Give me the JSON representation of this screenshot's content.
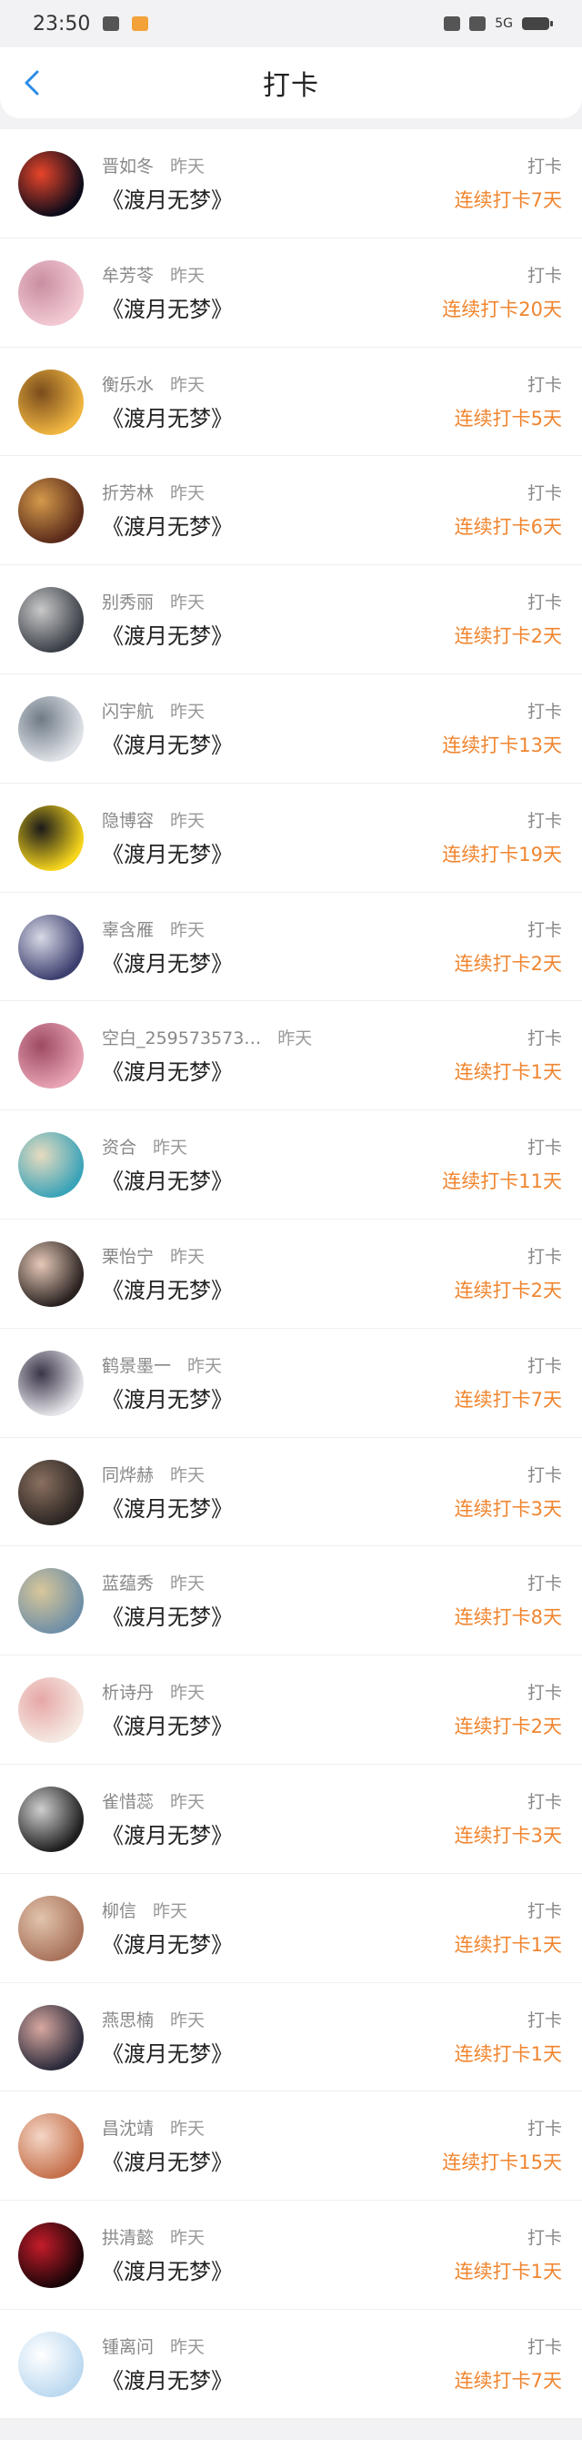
{
  "status_bar": {
    "time": "23:50",
    "network": "5G"
  },
  "header": {
    "title": "打卡"
  },
  "book_title": "《渡月无梦》",
  "checkin_label": "打卡",
  "colors": {
    "accent": "#f0852f",
    "back_icon": "#2b8be6"
  },
  "rows": [
    {
      "username": "晋如冬",
      "date": "昨天",
      "streak": "连续打卡7天",
      "avatar": [
        "#0b0b1a",
        "#e8452a"
      ]
    },
    {
      "username": "牟芳苓",
      "date": "昨天",
      "streak": "连续打卡20天",
      "avatar": [
        "#f2c9d3",
        "#c98ea1"
      ]
    },
    {
      "username": "衡乐水",
      "date": "昨天",
      "streak": "连续打卡5天",
      "avatar": [
        "#f0b640",
        "#7a4c1c"
      ]
    },
    {
      "username": "折芳林",
      "date": "昨天",
      "streak": "连续打卡6天",
      "avatar": [
        "#5a2a1a",
        "#d49a4b"
      ]
    },
    {
      "username": "别秀丽",
      "date": "昨天",
      "streak": "连续打卡2天",
      "avatar": [
        "#3a3f47",
        "#c9c9c9"
      ]
    },
    {
      "username": "闪宇航",
      "date": "昨天",
      "streak": "连续打卡13天",
      "avatar": [
        "#dfe3e8",
        "#6f7a86"
      ]
    },
    {
      "username": "隐博容",
      "date": "昨天",
      "streak": "连续打卡19天",
      "avatar": [
        "#f6d51c",
        "#1a1a1a"
      ]
    },
    {
      "username": "辜含雁",
      "date": "昨天",
      "streak": "连续打卡2天",
      "avatar": [
        "#3c3f6e",
        "#d7d9e6"
      ]
    },
    {
      "username": "空白_259573573…",
      "date": "昨天",
      "streak": "连续打卡1天",
      "avatar": [
        "#e7a3b3",
        "#9e4a63"
      ]
    },
    {
      "username": "资合",
      "date": "昨天",
      "streak": "连续打卡11天",
      "avatar": [
        "#3aa3b8",
        "#e8dcc0"
      ]
    },
    {
      "username": "栗怡宁",
      "date": "昨天",
      "streak": "连续打卡2天",
      "avatar": [
        "#2a2220",
        "#e6c9b8"
      ]
    },
    {
      "username": "鹤景墨一",
      "date": "昨天",
      "streak": "连续打卡7天",
      "avatar": [
        "#e6e6ea",
        "#3a3448"
      ]
    },
    {
      "username": "同烨赫",
      "date": "昨天",
      "streak": "连续打卡3天",
      "avatar": [
        "#2b2522",
        "#8a7060"
      ]
    },
    {
      "username": "蓝蕴秀",
      "date": "昨天",
      "streak": "连续打卡8天",
      "avatar": [
        "#6f8fa6",
        "#d8c79a"
      ]
    },
    {
      "username": "析诗丹",
      "date": "昨天",
      "streak": "连续打卡2天",
      "avatar": [
        "#f5e9e2",
        "#e6a7a7"
      ]
    },
    {
      "username": "雀惜蕊",
      "date": "昨天",
      "streak": "连续打卡3天",
      "avatar": [
        "#1e1e1e",
        "#cfcfcf"
      ]
    },
    {
      "username": "柳信",
      "date": "昨天",
      "streak": "连续打卡1天",
      "avatar": [
        "#a9735b",
        "#e2c4ad"
      ]
    },
    {
      "username": "燕思楠",
      "date": "昨天",
      "streak": "连续打卡1天",
      "avatar": [
        "#2a2a3a",
        "#d8a8a0"
      ]
    },
    {
      "username": "昌沈靖",
      "date": "昨天",
      "streak": "连续打卡15天",
      "avatar": [
        "#c5704b",
        "#f4d6c6"
      ]
    },
    {
      "username": "拱清懿",
      "date": "昨天",
      "streak": "连续打卡1天",
      "avatar": [
        "#1a0508",
        "#c41c2a"
      ]
    },
    {
      "username": "锺离问",
      "date": "昨天",
      "streak": "连续打卡7天",
      "avatar": [
        "#bcd9f0",
        "#ffffff"
      ]
    }
  ]
}
